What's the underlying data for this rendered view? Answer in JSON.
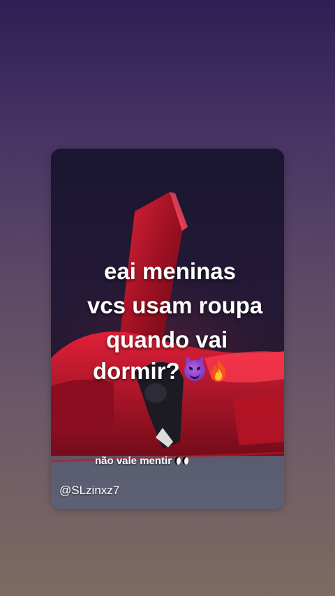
{
  "story": {
    "caption_lines": [
      "eai meninas",
      "vcs usam roupa",
      "quando vai",
      "dormir?"
    ],
    "caption_emojis": [
      "smiling-devil-emoji",
      "fire-emoji"
    ],
    "sub_caption": "não vale mentir",
    "sub_caption_emoji": "eyes-emoji",
    "username": "@SLzinxz7"
  },
  "colors": {
    "background_top": "#2e1f54",
    "background_bottom": "#7d6a62",
    "car_red": "#c0182a",
    "text": "#ffffff"
  }
}
